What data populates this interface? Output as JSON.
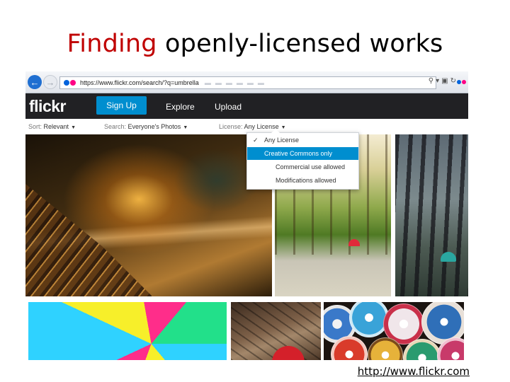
{
  "slide": {
    "title_accent": "Finding",
    "title_rest": "openly-licensed works",
    "footer_link": "http://www.flickr.com"
  },
  "browser": {
    "url": "https://www.flickr.com/search/?q=umbrella"
  },
  "flickr": {
    "logo": "flickr",
    "signup_label": "Sign Up",
    "nav": [
      "Explore",
      "Upload"
    ],
    "brand_colors": {
      "blue": "#0063dc",
      "pink": "#ff0084",
      "button": "#008ecf",
      "bar": "#212124"
    }
  },
  "filters": {
    "sort_label": "Sort:",
    "sort_value": "Relevant",
    "search_label": "Search:",
    "search_value": "Everyone's Photos",
    "license_label": "License:",
    "license_value": "Any License"
  },
  "license_menu": {
    "items": [
      "Any License",
      "Creative Commons only",
      "Commercial use allowed",
      "Modifications allowed"
    ],
    "checked_index": 0,
    "highlighted_index": 1
  }
}
